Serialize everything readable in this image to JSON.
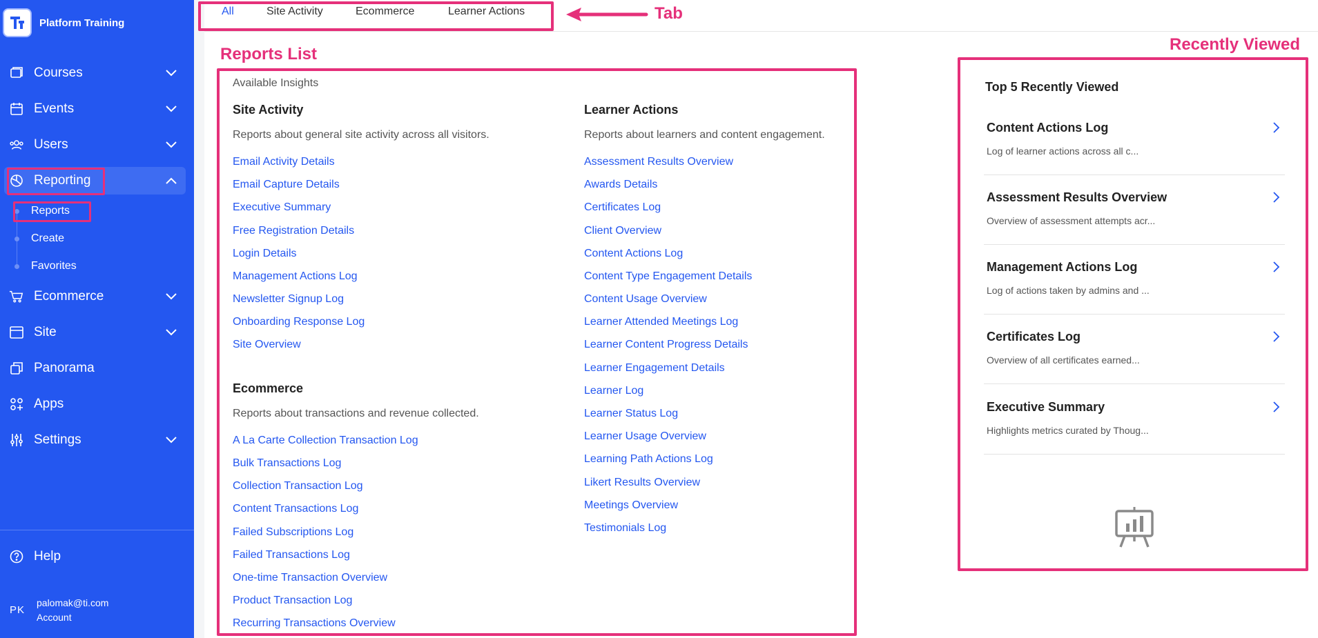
{
  "brand": {
    "name": "Platform Training",
    "logo_letter": "T"
  },
  "sidebar": {
    "items": [
      {
        "label": "Courses",
        "icon": "book-icon",
        "chevron": "chevron-down-icon"
      },
      {
        "label": "Events",
        "icon": "calendar-icon",
        "chevron": "chevron-down-icon"
      },
      {
        "label": "Users",
        "icon": "users-icon",
        "chevron": "chevron-down-icon"
      },
      {
        "label": "Reporting",
        "icon": "pie-chart-icon",
        "chevron": "chevron-up-icon"
      },
      {
        "label": "Ecommerce",
        "icon": "cart-icon",
        "chevron": "chevron-down-icon"
      },
      {
        "label": "Site",
        "icon": "browser-icon",
        "chevron": "chevron-down-icon"
      },
      {
        "label": "Panorama",
        "icon": "copy-icon",
        "chevron": ""
      },
      {
        "label": "Apps",
        "icon": "apps-icon",
        "chevron": ""
      },
      {
        "label": "Settings",
        "icon": "sliders-icon",
        "chevron": "chevron-down-icon"
      }
    ],
    "sub_items": [
      {
        "label": "Reports"
      },
      {
        "label": "Create"
      },
      {
        "label": "Favorites"
      }
    ],
    "help": {
      "label": "Help",
      "icon": "help-icon"
    },
    "account": {
      "initials": "PK",
      "email": "palomak@ti.com",
      "label": "Account"
    }
  },
  "tabs": [
    {
      "label": "All",
      "active": true
    },
    {
      "label": "Site Activity",
      "active": false
    },
    {
      "label": "Ecommerce",
      "active": false
    },
    {
      "label": "Learner Actions",
      "active": false
    }
  ],
  "annotations": {
    "tab": "Tab",
    "reports_list": "Reports List",
    "recently_viewed": "Recently Viewed"
  },
  "reports": {
    "heading": "Available Insights",
    "site_activity": {
      "title": "Site Activity",
      "description": "Reports about general site activity across all visitors.",
      "links": [
        "Email Activity Details",
        "Email Capture Details",
        "Executive Summary",
        "Free Registration Details",
        "Login Details",
        "Management Actions Log",
        "Newsletter Signup Log",
        "Onboarding Response Log",
        "Site Overview"
      ]
    },
    "ecommerce": {
      "title": "Ecommerce",
      "description": "Reports about transactions and revenue collected.",
      "links": [
        "A La Carte Collection Transaction Log",
        "Bulk Transactions Log",
        "Collection Transaction Log",
        "Content Transactions Log",
        "Failed Subscriptions Log",
        "Failed Transactions Log",
        "One-time Transaction Overview",
        "Product Transaction Log",
        "Recurring Transactions Overview"
      ]
    },
    "learner_actions": {
      "title": "Learner Actions",
      "description": "Reports about learners and content engagement.",
      "links": [
        "Assessment Results Overview",
        "Awards Details",
        "Certificates Log",
        "Client Overview",
        "Content Actions Log",
        "Content Type Engagement Details",
        "Content Usage Overview",
        "Learner Attended Meetings Log",
        "Learner Content Progress Details",
        "Learner Engagement Details",
        "Learner Log",
        "Learner Status Log",
        "Learner Usage Overview",
        "Learning Path Actions Log",
        "Likert Results Overview",
        "Meetings Overview",
        "Testimonials Log"
      ]
    }
  },
  "recently_viewed": {
    "title": "Top 5 Recently Viewed",
    "items": [
      {
        "name": "Content Actions Log",
        "description": "Log of learner actions across all c..."
      },
      {
        "name": "Assessment Results Overview",
        "description": "Overview of assessment attempts acr..."
      },
      {
        "name": "Management Actions Log",
        "description": "Log of actions taken by admins and ..."
      },
      {
        "name": "Certificates Log",
        "description": "Overview of all certificates earned..."
      },
      {
        "name": "Executive Summary",
        "description": "Highlights metrics curated by Thoug..."
      }
    ]
  },
  "colors": {
    "sidebar": "#2457f0",
    "link": "#2457f0",
    "annotation": "#e5307a"
  }
}
